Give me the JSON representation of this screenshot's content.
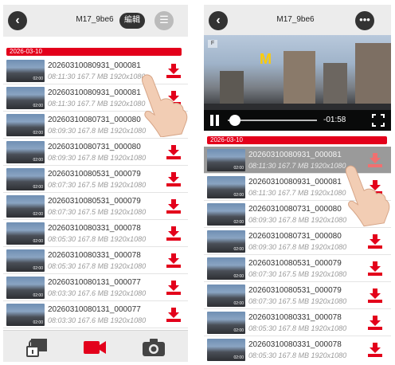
{
  "left": {
    "title": "M17_9be6",
    "edit_label": "編輯",
    "date": "2026-03-10",
    "rows": [
      {
        "name": "20260310080931_000081",
        "meta": "08:11:30 167.7 MB 1920x1080",
        "duration": "02:00"
      },
      {
        "name": "20260310080931_000081",
        "meta": "08:11:30 167.7 MB 1920x1080",
        "duration": "02:00"
      },
      {
        "name": "20260310080731_000080",
        "meta": "08:09:30 167.8 MB 1920x1080",
        "duration": "02:00"
      },
      {
        "name": "20260310080731_000080",
        "meta": "08:09:30 167.8 MB 1920x1080",
        "duration": "02:00"
      },
      {
        "name": "20260310080531_000079",
        "meta": "08:07:30 167.5 MB 1920x1080",
        "duration": "02:00"
      },
      {
        "name": "20260310080531_000079",
        "meta": "08:07:30 167.5 MB 1920x1080",
        "duration": "02:00"
      },
      {
        "name": "20260310080331_000078",
        "meta": "08:05:30 167.8 MB 1920x1080",
        "duration": "02:00"
      },
      {
        "name": "20260310080331_000078",
        "meta": "08:05:30 167.8 MB 1920x1080",
        "duration": "02:00"
      },
      {
        "name": "20260310080131_000077",
        "meta": "08:03:30 167.6 MB 1920x1080",
        "duration": "02:00"
      },
      {
        "name": "20260310080131_000077",
        "meta": "08:03:30 167.6 MB 1920x1080",
        "duration": "02:00"
      }
    ],
    "tabs": [
      "lock-icon",
      "video-camera-icon",
      "photo-camera-icon"
    ]
  },
  "right": {
    "title": "M17_9be6",
    "video_time": "-01:58",
    "date": "2026-03-10",
    "rows": [
      {
        "name": "20260310080931_000081",
        "meta": "08:11:30 167.7 MB 1920x1080",
        "duration": "02:00"
      },
      {
        "name": "20260310080931_000081",
        "meta": "08:11:30 167.7 MB 1920x1080",
        "duration": "02:00"
      },
      {
        "name": "20260310080731_000080",
        "meta": "08:09:30 167.8 MB 1920x1080",
        "duration": "02:00"
      },
      {
        "name": "20260310080731_000080",
        "meta": "08:09:30 167.8 MB 1920x1080",
        "duration": "02:00"
      },
      {
        "name": "20260310080531_000079",
        "meta": "08:07:30 167.5 MB 1920x1080",
        "duration": "02:00"
      },
      {
        "name": "20260310080531_000079",
        "meta": "08:07:30 167.5 MB 1920x1080",
        "duration": "02:00"
      },
      {
        "name": "20260310080331_000078",
        "meta": "08:05:30 167.8 MB 1920x1080",
        "duration": "02:00"
      },
      {
        "name": "20260310080331_000078",
        "meta": "08:05:30 167.8 MB 1920x1080",
        "duration": "02:00"
      }
    ]
  },
  "colors": {
    "accent": "#e3001b",
    "bar": "#ececec",
    "dark": "#333333"
  }
}
